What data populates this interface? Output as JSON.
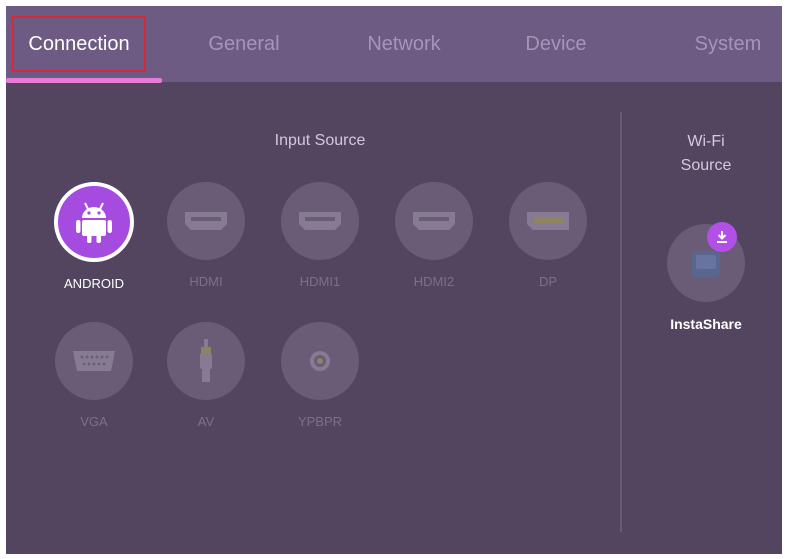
{
  "tabs": [
    {
      "label": "Connection",
      "active": true
    },
    {
      "label": "General",
      "active": false
    },
    {
      "label": "Network",
      "active": false
    },
    {
      "label": "Device",
      "active": false
    },
    {
      "label": "System",
      "active": false
    }
  ],
  "input_source": {
    "title": "Input Source",
    "items": [
      {
        "label": "ANDROID",
        "icon": "android-icon",
        "selected": true
      },
      {
        "label": "HDMI",
        "icon": "hdmi-icon",
        "selected": false
      },
      {
        "label": "HDMI1",
        "icon": "hdmi-icon",
        "selected": false
      },
      {
        "label": "HDMI2",
        "icon": "hdmi-icon",
        "selected": false
      },
      {
        "label": "DP",
        "icon": "displayport-icon",
        "selected": false
      },
      {
        "label": "VGA",
        "icon": "vga-icon",
        "selected": false
      },
      {
        "label": "AV",
        "icon": "av-plug-icon",
        "selected": false
      },
      {
        "label": "YPBPR",
        "icon": "rca-icon",
        "selected": false
      }
    ]
  },
  "wifi_source": {
    "title_line1": "Wi-Fi",
    "title_line2": "Source",
    "items": [
      {
        "label": "InstaShare",
        "icon": "instashare-icon",
        "badge_icon": "download-icon"
      }
    ]
  },
  "colors": {
    "background": "#534560",
    "tab_bar": "#6e5b84",
    "accent": "#a54be0",
    "underline": "#e77bd7",
    "highlight_box": "#d8283c"
  }
}
